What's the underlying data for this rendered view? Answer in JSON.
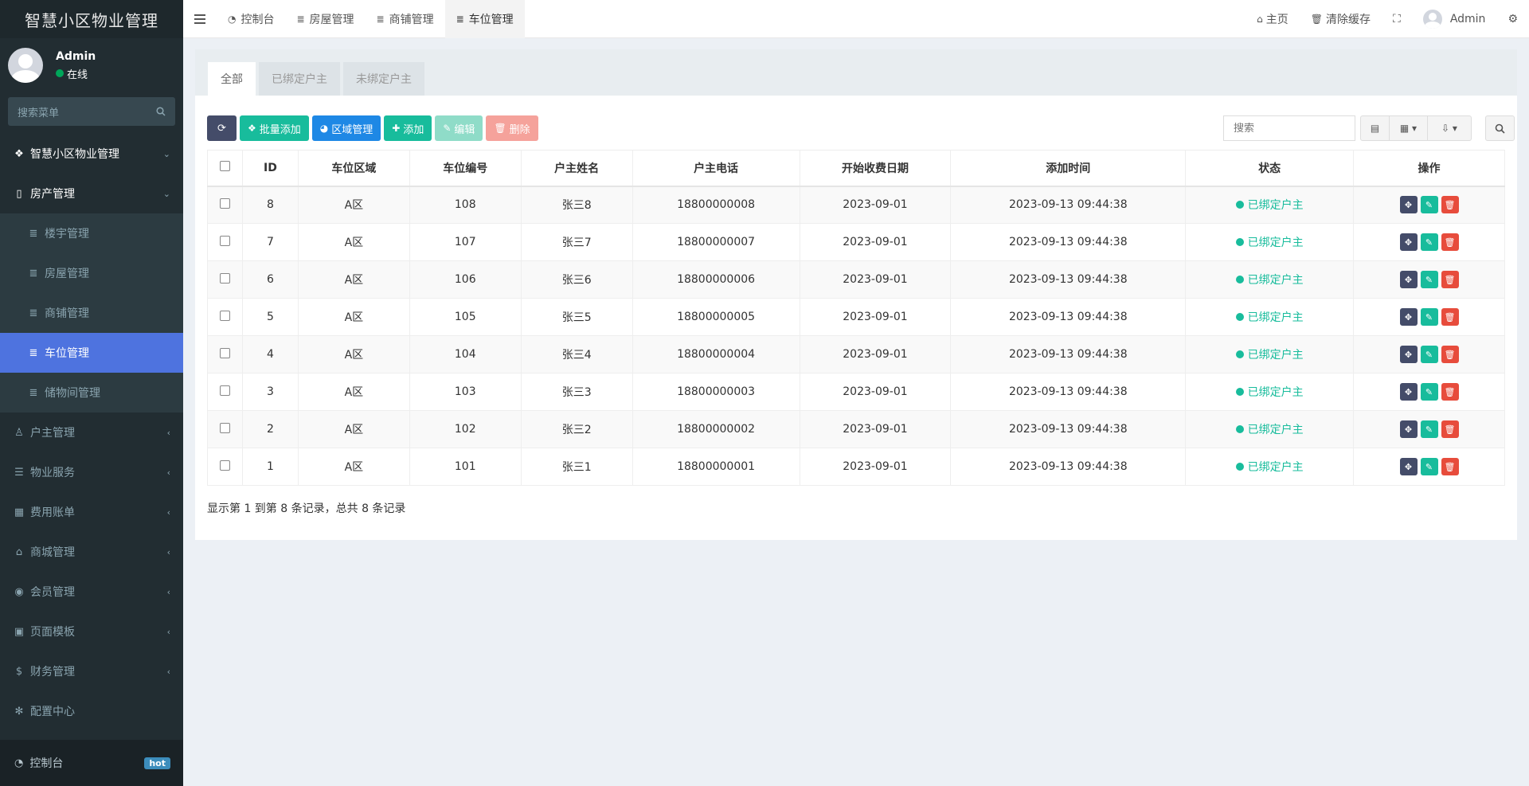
{
  "app": {
    "logo": "智慧小区物业管理",
    "user_name": "Admin",
    "user_status": "在线",
    "search_placeholder": "搜索菜单"
  },
  "sidebar": {
    "items": [
      {
        "label": "智慧小区物业管理",
        "icon": "cubes-icon",
        "type": "bold",
        "chevron": "down"
      },
      {
        "label": "房产管理",
        "icon": "building-icon",
        "type": "bold",
        "chevron": "down"
      },
      {
        "label": "楼宇管理",
        "icon": "list-icon",
        "type": "sub"
      },
      {
        "label": "房屋管理",
        "icon": "list-icon",
        "type": "sub"
      },
      {
        "label": "商铺管理",
        "icon": "list-icon",
        "type": "sub"
      },
      {
        "label": "车位管理",
        "icon": "list-icon",
        "type": "active"
      },
      {
        "label": "储物间管理",
        "icon": "list-icon",
        "type": "sub"
      },
      {
        "label": "户主管理",
        "icon": "user-icon",
        "type": "group",
        "chevron": "left"
      },
      {
        "label": "物业服务",
        "icon": "server-icon",
        "type": "group",
        "chevron": "left"
      },
      {
        "label": "费用账单",
        "icon": "calculator-icon",
        "type": "group",
        "chevron": "left"
      },
      {
        "label": "商城管理",
        "icon": "basket-icon",
        "type": "group",
        "chevron": "left"
      },
      {
        "label": "会员管理",
        "icon": "user-circle-icon",
        "type": "group",
        "chevron": "left"
      },
      {
        "label": "页面模板",
        "icon": "money-icon",
        "type": "group",
        "chevron": "left"
      },
      {
        "label": "财务管理",
        "icon": "dollar-icon",
        "type": "group",
        "chevron": "left"
      },
      {
        "label": "配置中心",
        "icon": "gear-icon",
        "type": "group"
      }
    ],
    "bottom_label": "控制台",
    "bottom_badge": "hot"
  },
  "header": {
    "tabs": [
      {
        "label": "控制台",
        "icon": "dashboard-icon"
      },
      {
        "label": "房屋管理",
        "icon": "list-icon"
      },
      {
        "label": "商铺管理",
        "icon": "list-icon"
      },
      {
        "label": "车位管理",
        "icon": "list-icon",
        "active": true
      }
    ],
    "home_label": "主页",
    "clear_cache_label": "清除缓存",
    "user_label": "Admin"
  },
  "filter_tabs": [
    "全部",
    "已绑定户主",
    "未绑定户主"
  ],
  "toolbar": {
    "batch_add": "批量添加",
    "area_manage": "区域管理",
    "add": "添加",
    "edit": "编辑",
    "delete": "删除",
    "search_placeholder": "搜索"
  },
  "table": {
    "columns": [
      "ID",
      "车位区域",
      "车位编号",
      "户主姓名",
      "户主电话",
      "开始收费日期",
      "添加时间",
      "状态",
      "操作"
    ],
    "rows": [
      {
        "id": "8",
        "area": "A区",
        "number": "108",
        "owner": "张三8",
        "phone": "18800000008",
        "start": "2023-09-01",
        "created": "2023-09-13 09:44:38",
        "status": "已绑定户主"
      },
      {
        "id": "7",
        "area": "A区",
        "number": "107",
        "owner": "张三7",
        "phone": "18800000007",
        "start": "2023-09-01",
        "created": "2023-09-13 09:44:38",
        "status": "已绑定户主"
      },
      {
        "id": "6",
        "area": "A区",
        "number": "106",
        "owner": "张三6",
        "phone": "18800000006",
        "start": "2023-09-01",
        "created": "2023-09-13 09:44:38",
        "status": "已绑定户主"
      },
      {
        "id": "5",
        "area": "A区",
        "number": "105",
        "owner": "张三5",
        "phone": "18800000005",
        "start": "2023-09-01",
        "created": "2023-09-13 09:44:38",
        "status": "已绑定户主"
      },
      {
        "id": "4",
        "area": "A区",
        "number": "104",
        "owner": "张三4",
        "phone": "18800000004",
        "start": "2023-09-01",
        "created": "2023-09-13 09:44:38",
        "status": "已绑定户主"
      },
      {
        "id": "3",
        "area": "A区",
        "number": "103",
        "owner": "张三3",
        "phone": "18800000003",
        "start": "2023-09-01",
        "created": "2023-09-13 09:44:38",
        "status": "已绑定户主"
      },
      {
        "id": "2",
        "area": "A区",
        "number": "102",
        "owner": "张三2",
        "phone": "18800000002",
        "start": "2023-09-01",
        "created": "2023-09-13 09:44:38",
        "status": "已绑定户主"
      },
      {
        "id": "1",
        "area": "A区",
        "number": "101",
        "owner": "张三1",
        "phone": "18800000001",
        "start": "2023-09-01",
        "created": "2023-09-13 09:44:38",
        "status": "已绑定户主"
      }
    ]
  },
  "pager_info": "显示第 1 到第 8 条记录，总共 8 条记录"
}
